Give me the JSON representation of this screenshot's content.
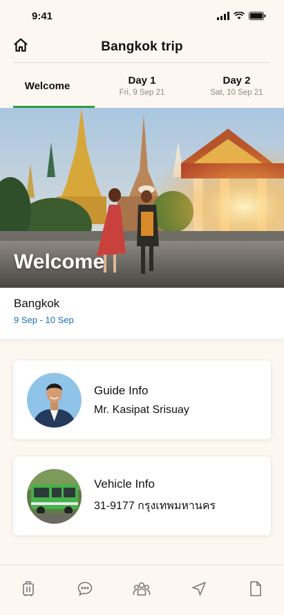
{
  "status_bar": {
    "time": "9:41"
  },
  "header": {
    "title": "Bangkok trip"
  },
  "tabs": [
    {
      "label": "Welcome",
      "sub": "",
      "active": true
    },
    {
      "label": "Day 1",
      "sub": "Fri, 9 Sep 21",
      "active": false
    },
    {
      "label": "Day 2",
      "sub": "Sat, 10 Sep 21",
      "active": false
    }
  ],
  "hero": {
    "title": "Welcome"
  },
  "destination": {
    "name": "Bangkok",
    "dates": "9 Sep - 10 Sep"
  },
  "guide": {
    "title": "Guide Info",
    "value": "Mr. Kasipat Srisuay"
  },
  "vehicle": {
    "title": "Vehicle Info",
    "value": "31-9177 กรุงเทพมหานคร"
  },
  "bottom_nav": [
    "luggage-icon",
    "chat-icon",
    "group-icon",
    "navigation-icon",
    "document-icon"
  ],
  "colors": {
    "accent": "#2f9c41",
    "date_blue": "#1b6fb3",
    "background": "#fcf8f1"
  }
}
